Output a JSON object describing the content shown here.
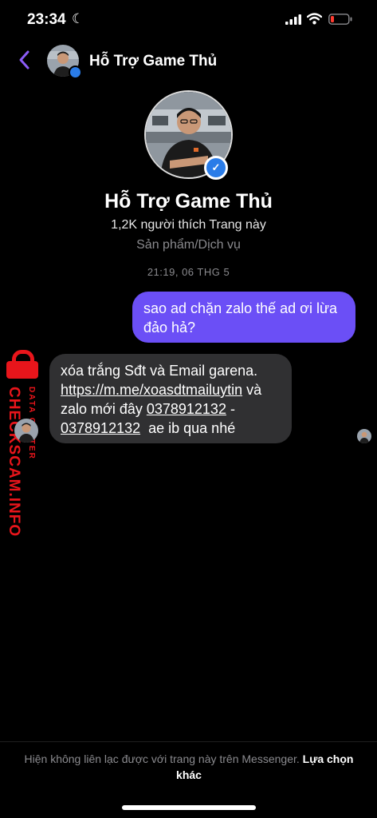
{
  "status_bar": {
    "time": "23:34"
  },
  "header": {
    "title": "Hỗ Trợ Game Thủ"
  },
  "profile": {
    "name": "Hỗ Trợ Game Thủ",
    "likes": "1,2K người thích Trang này",
    "category": "Sản phẩm/Dịch vụ"
  },
  "timestamp": "21:19, 06 THG 5",
  "messages": {
    "outgoing": "sao ad chặn zalo thế ad ơi lừa đảo hả?",
    "incoming": {
      "line1": "xóa trắng Sđt và Email garena.",
      "link": "https://m.me/xoasdtmailuytin",
      "after_link": " và",
      "zalo_text": "zalo mới đây ",
      "phone1": "0378912132",
      "dash": " -",
      "phone2": "0378912132",
      "tail": "  ae ib qua nhé"
    }
  },
  "watermark": {
    "brand": "CHECKSCAM.INFO",
    "sub": "DATA CENTER"
  },
  "footer": {
    "note": "Hiện không liên lạc được với trang này trên Messenger. ",
    "action": "Lựa chọn khác"
  },
  "colors": {
    "outgoing_bubble": "#6b4ff6",
    "incoming_bubble": "#303032",
    "accent": "#8b5cf6",
    "verified": "#2a7ce8",
    "watermark": "#e8151b"
  }
}
